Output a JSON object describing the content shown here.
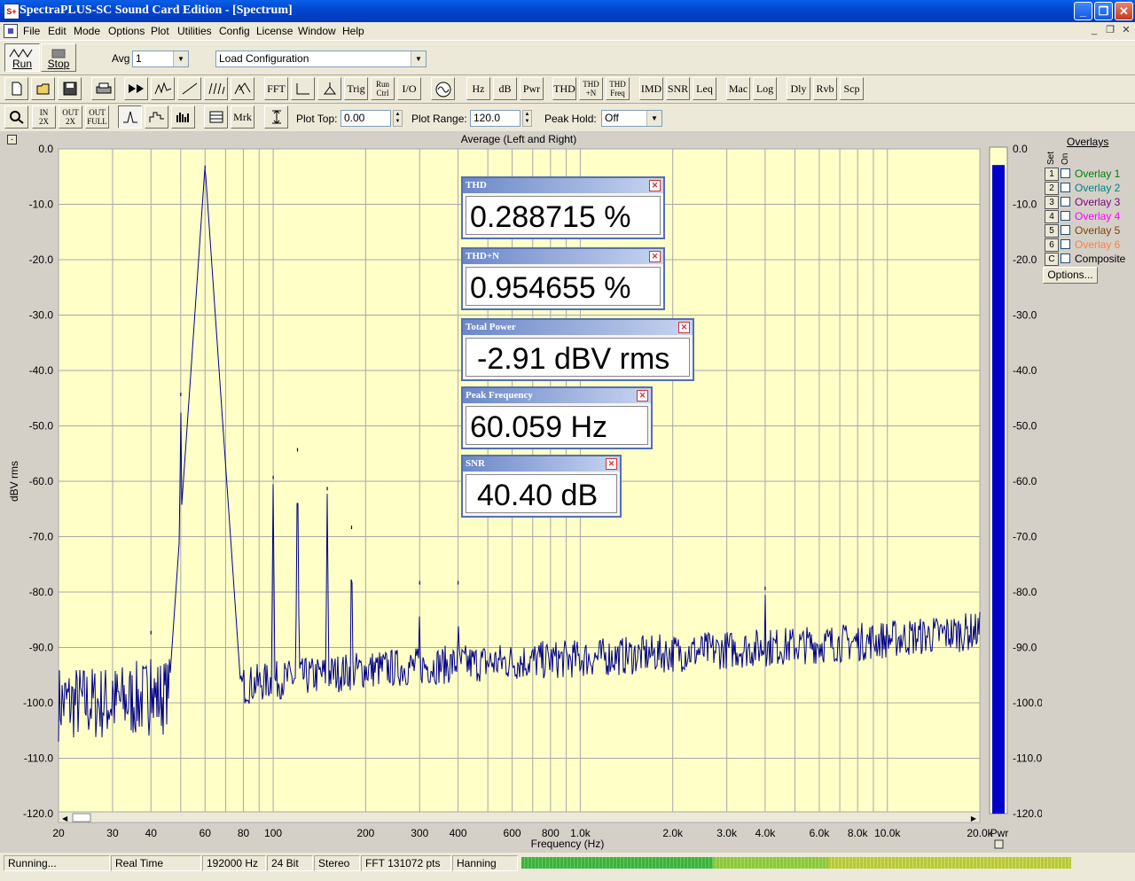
{
  "window": {
    "title": "SpectraPLUS-SC Sound Card Edition - [Spectrum]",
    "app_icon": "spectrum-app-icon"
  },
  "menu": [
    "File",
    "Edit",
    "Mode",
    "Options",
    "Plot",
    "Utilities",
    "Config",
    "License",
    "Window",
    "Help"
  ],
  "toolbar1": {
    "run_label": "Run",
    "stop_label": "Stop",
    "avg_label": "Avg",
    "avg_value": "1",
    "config_value": "Load Configuration"
  },
  "toolbar2": {
    "buttons": [
      "FFT",
      "Trig",
      "Run Ctrl",
      "I/O",
      "Hz",
      "dB",
      "Pwr",
      "THD",
      "THD +N",
      "THD Freq",
      "IMD",
      "SNR",
      "Leq",
      "Mac",
      "Log",
      "Dly",
      "Rvb",
      "Scp"
    ]
  },
  "toolbar3": {
    "mrk_label": "Mrk",
    "plot_top_label": "Plot Top:",
    "plot_top_value": "0.00",
    "plot_range_label": "Plot Range:",
    "plot_range_value": "120.0",
    "peak_hold_label": "Peak Hold:",
    "peak_hold_value": "Off"
  },
  "meters": {
    "thd": {
      "title": "THD",
      "value": "0.288715 %"
    },
    "thdn": {
      "title": "THD+N",
      "value": "0.954655 %"
    },
    "total_power": {
      "title": "Total Power",
      "value": "-2.91 dBV rms"
    },
    "peak_freq": {
      "title": "Peak Frequency",
      "value": "60.059 Hz"
    },
    "snr": {
      "title": "SNR",
      "value": "40.40 dB"
    }
  },
  "overlays": {
    "title": "Overlays",
    "set_label": "Set",
    "on_label": "On",
    "options_button": "Options...",
    "items": [
      {
        "set": "1",
        "name": "Overlay 1",
        "color": "#008000"
      },
      {
        "set": "2",
        "name": "Overlay 2",
        "color": "#008080"
      },
      {
        "set": "3",
        "name": "Overlay 3",
        "color": "#800080"
      },
      {
        "set": "4",
        "name": "Overlay 4",
        "color": "#ff00ff"
      },
      {
        "set": "5",
        "name": "Overlay 5",
        "color": "#804000"
      },
      {
        "set": "6",
        "name": "Overlay 6",
        "color": "#ff8040"
      },
      {
        "set": "C",
        "name": "Composite",
        "color": "#000000"
      }
    ]
  },
  "chart_data": {
    "type": "line",
    "title": "Average (Left and Right)",
    "xlabel": "Frequency (Hz)",
    "ylabel": "dBV rms",
    "xscale": "log",
    "xlim": [
      20,
      20000
    ],
    "ylim": [
      -120,
      0
    ],
    "grid": true,
    "x_ticks": [
      20,
      30,
      40,
      60,
      80,
      100,
      200,
      300,
      400,
      600,
      800,
      1000,
      2000,
      3000,
      4000,
      6000,
      8000,
      10000,
      20000
    ],
    "x_tick_labels": [
      "20",
      "30",
      "40",
      "60",
      "80",
      "100",
      "200",
      "300",
      "400",
      "600",
      "800",
      "1.0k",
      "2.0k",
      "3.0k",
      "4.0k",
      "6.0k",
      "8.0k",
      "10.0k",
      "20.0k"
    ],
    "y_ticks": [
      0,
      -10,
      -20,
      -30,
      -40,
      -50,
      -60,
      -70,
      -80,
      -90,
      -100,
      -110,
      -120
    ],
    "y_tick_labels": [
      "0.0",
      "-10.0",
      "-20.0",
      "-30.0",
      "-40.0",
      "-50.0",
      "-60.0",
      "-70.0",
      "-80.0",
      "-90.0",
      "-100.0",
      "-110.0",
      "-120.0"
    ],
    "line_color": "#00008b",
    "plot_bg": "#ffffc8",
    "noise_floor": [
      [
        20,
        -100
      ],
      [
        30,
        -100
      ],
      [
        40,
        -99
      ],
      [
        60,
        -98
      ],
      [
        100,
        -96
      ],
      [
        200,
        -94
      ],
      [
        400,
        -93
      ],
      [
        1000,
        -92
      ],
      [
        2000,
        -91
      ],
      [
        4000,
        -90
      ],
      [
        8000,
        -89
      ],
      [
        20000,
        -87
      ]
    ],
    "peaks": [
      {
        "freq": 30,
        "db": -96
      },
      {
        "freq": 40,
        "db": -87
      },
      {
        "freq": 50,
        "db": -44
      },
      {
        "freq": 60,
        "db": -3
      },
      {
        "freq": 100,
        "db": -59
      },
      {
        "freq": 120,
        "db": -54
      },
      {
        "freq": 150,
        "db": -61
      },
      {
        "freq": 180,
        "db": -68
      },
      {
        "freq": 300,
        "db": -78
      },
      {
        "freq": 400,
        "db": -78
      },
      {
        "freq": 4000,
        "db": -79
      }
    ],
    "pwr_bar": {
      "label": "Pwr",
      "value": -2.91,
      "color": "#0000cd"
    }
  },
  "statusbar": {
    "status": "Running...",
    "mode": "Real Time",
    "rate": "192000 Hz",
    "bits": "24 Bit",
    "channels": "Stereo",
    "fft": "FFT 131072 pts",
    "window": "Hanning"
  }
}
